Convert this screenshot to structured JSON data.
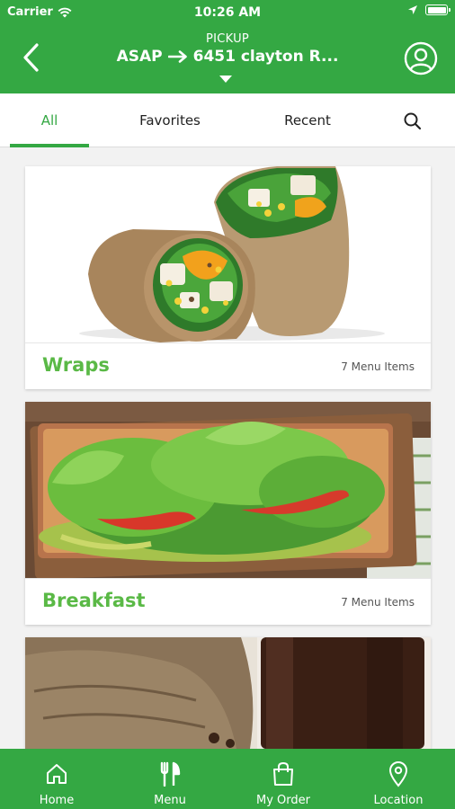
{
  "status_bar": {
    "carrier": "Carrier",
    "time": "10:26 AM"
  },
  "header": {
    "pickup_label": "PICKUP",
    "route_time": "ASAP",
    "route_address": "6451 clayton R...",
    "icons": [
      "back-icon",
      "arrow-right-icon",
      "caret-down-icon",
      "profile-icon"
    ]
  },
  "tabs": [
    {
      "label": "All",
      "active": true
    },
    {
      "label": "Favorites",
      "active": false
    },
    {
      "label": "Recent",
      "active": false
    }
  ],
  "categories": [
    {
      "title": "Wraps",
      "count": "7 Menu Items",
      "image": "wraps-photo"
    },
    {
      "title": "Breakfast",
      "count": "7 Menu Items",
      "image": "breakfast-flatbread-photo"
    },
    {
      "title": "",
      "count": "",
      "image": "iced-coffee-photo"
    }
  ],
  "bottom_nav": [
    {
      "label": "Home",
      "icon": "home-icon"
    },
    {
      "label": "Menu",
      "icon": "utensils-icon"
    },
    {
      "label": "My Order",
      "icon": "shopping-bag-icon"
    },
    {
      "label": "Location",
      "icon": "location-pin-icon"
    }
  ],
  "colors": {
    "brand_green": "#34a843",
    "title_green": "#5ab946"
  }
}
